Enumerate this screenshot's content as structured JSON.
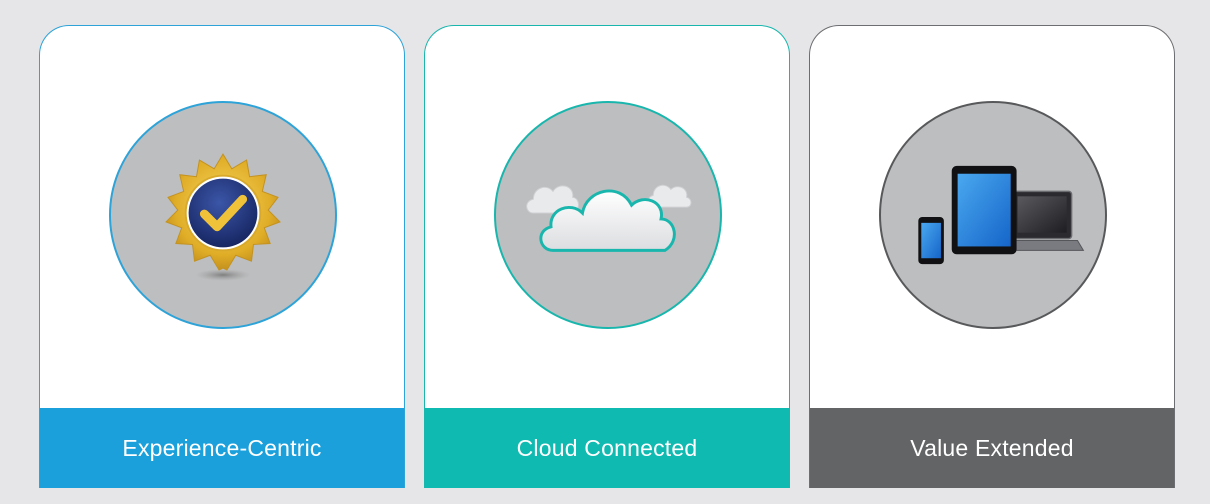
{
  "cards": [
    {
      "label": "Experience-Centric",
      "icon": "gold-seal-checkmark-icon",
      "accent": "#1ba0dc"
    },
    {
      "label": "Cloud Connected",
      "icon": "cloud-icon",
      "accent": "#0fbab1"
    },
    {
      "label": "Value Extended",
      "icon": "devices-icon",
      "accent": "#636466"
    }
  ]
}
